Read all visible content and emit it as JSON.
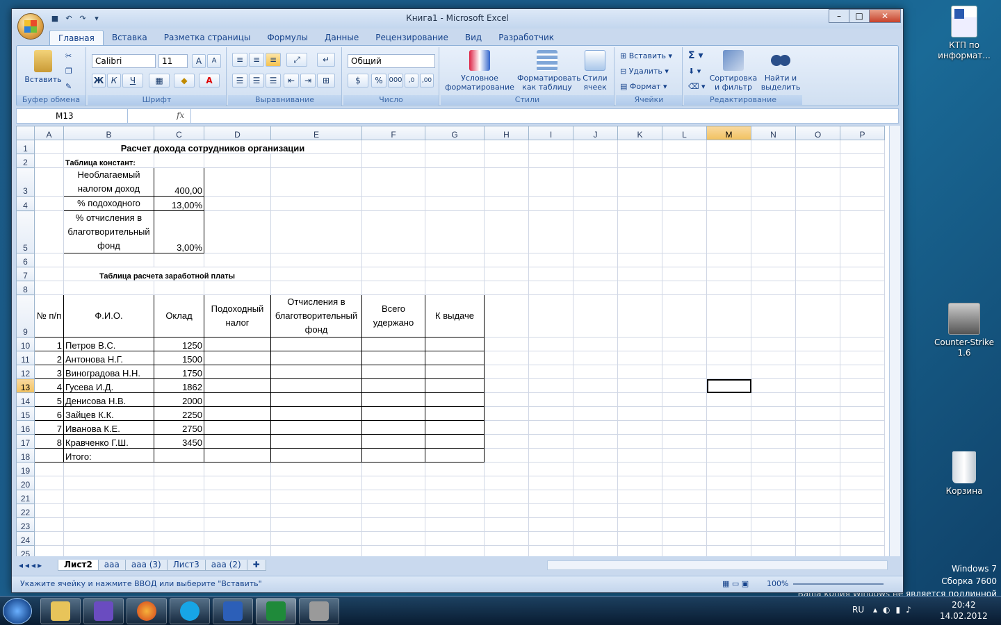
{
  "window": {
    "title": "Книга1 - Microsoft Excel"
  },
  "tabs": [
    "Главная",
    "Вставка",
    "Разметка страницы",
    "Формулы",
    "Данные",
    "Рецензирование",
    "Вид",
    "Разработчик"
  ],
  "ribbon": {
    "clipboard": {
      "label": "Буфер обмена",
      "paste": "Вставить"
    },
    "font": {
      "label": "Шрифт",
      "name": "Calibri",
      "size": "11"
    },
    "align": {
      "label": "Выравнивание"
    },
    "number": {
      "label": "Число",
      "format": "Общий"
    },
    "styles": {
      "label": "Стили",
      "cond": "Условное форматирование",
      "astable": "Форматировать как таблицу",
      "cell": "Стили ячеек"
    },
    "cells": {
      "label": "Ячейки",
      "insert": "Вставить",
      "delete": "Удалить",
      "format": "Формат"
    },
    "edit": {
      "label": "Редактирование",
      "sort": "Сортировка и фильтр",
      "find": "Найти и выделить"
    }
  },
  "formula": {
    "namebox": "M13",
    "fx": "fx",
    "value": ""
  },
  "columns": [
    "A",
    "B",
    "C",
    "D",
    "E",
    "F",
    "G",
    "H",
    "I",
    "J",
    "K",
    "L",
    "M",
    "N",
    "O",
    "P"
  ],
  "selected_col": "M",
  "selected_row": 13,
  "sheet": {
    "title": "Расчет дохода сотрудников организации",
    "consts_title": "Таблица констант:",
    "consts": [
      [
        "Необлагаемый налогом доход",
        "400,00"
      ],
      [
        "% подоходного",
        "13,00%"
      ],
      [
        "% отчисления в благотворительный фонд",
        "3,00%"
      ]
    ],
    "salary_title": "Таблица расчета заработной платы",
    "headers": [
      "№ п/п",
      "Ф.И.О.",
      "Оклад",
      "Подоходный налог",
      "Отчисления в благотворительный фонд",
      "Всего удержано",
      "К выдаче"
    ],
    "rows": [
      [
        "1",
        "Петров В.С.",
        "1250"
      ],
      [
        "2",
        "Антонова Н.Г.",
        "1500"
      ],
      [
        "3",
        "Виноградова Н.Н.",
        "1750"
      ],
      [
        "4",
        "Гусева И.Д.",
        "1862"
      ],
      [
        "5",
        "Денисова Н.В.",
        "2000"
      ],
      [
        "6",
        "Зайцев К.К.",
        "2250"
      ],
      [
        "7",
        "Иванова К.Е.",
        "2750"
      ],
      [
        "8",
        "Кравченко Г.Ш.",
        "3450"
      ]
    ],
    "total": "Итого:"
  },
  "sheettabs": [
    "Лист2",
    "ааа",
    "ааа (3)",
    "Лист3",
    "ааа (2)"
  ],
  "active_sheet": "Лист2",
  "status": {
    "text": "Укажите ячейку и нажмите ВВОД или выберите \"Вставить\"",
    "zoom": "100%"
  },
  "desktop": {
    "icons": [
      "КТП по информат...",
      "Counter-Strike 1.6",
      "Корзина"
    ],
    "watermark": [
      "Windows 7",
      "Сборка 7600",
      "Ваша копия Windows не является подлинной"
    ]
  },
  "tray": {
    "lang": "RU",
    "time": "20:42",
    "date": "14.02.2012"
  }
}
